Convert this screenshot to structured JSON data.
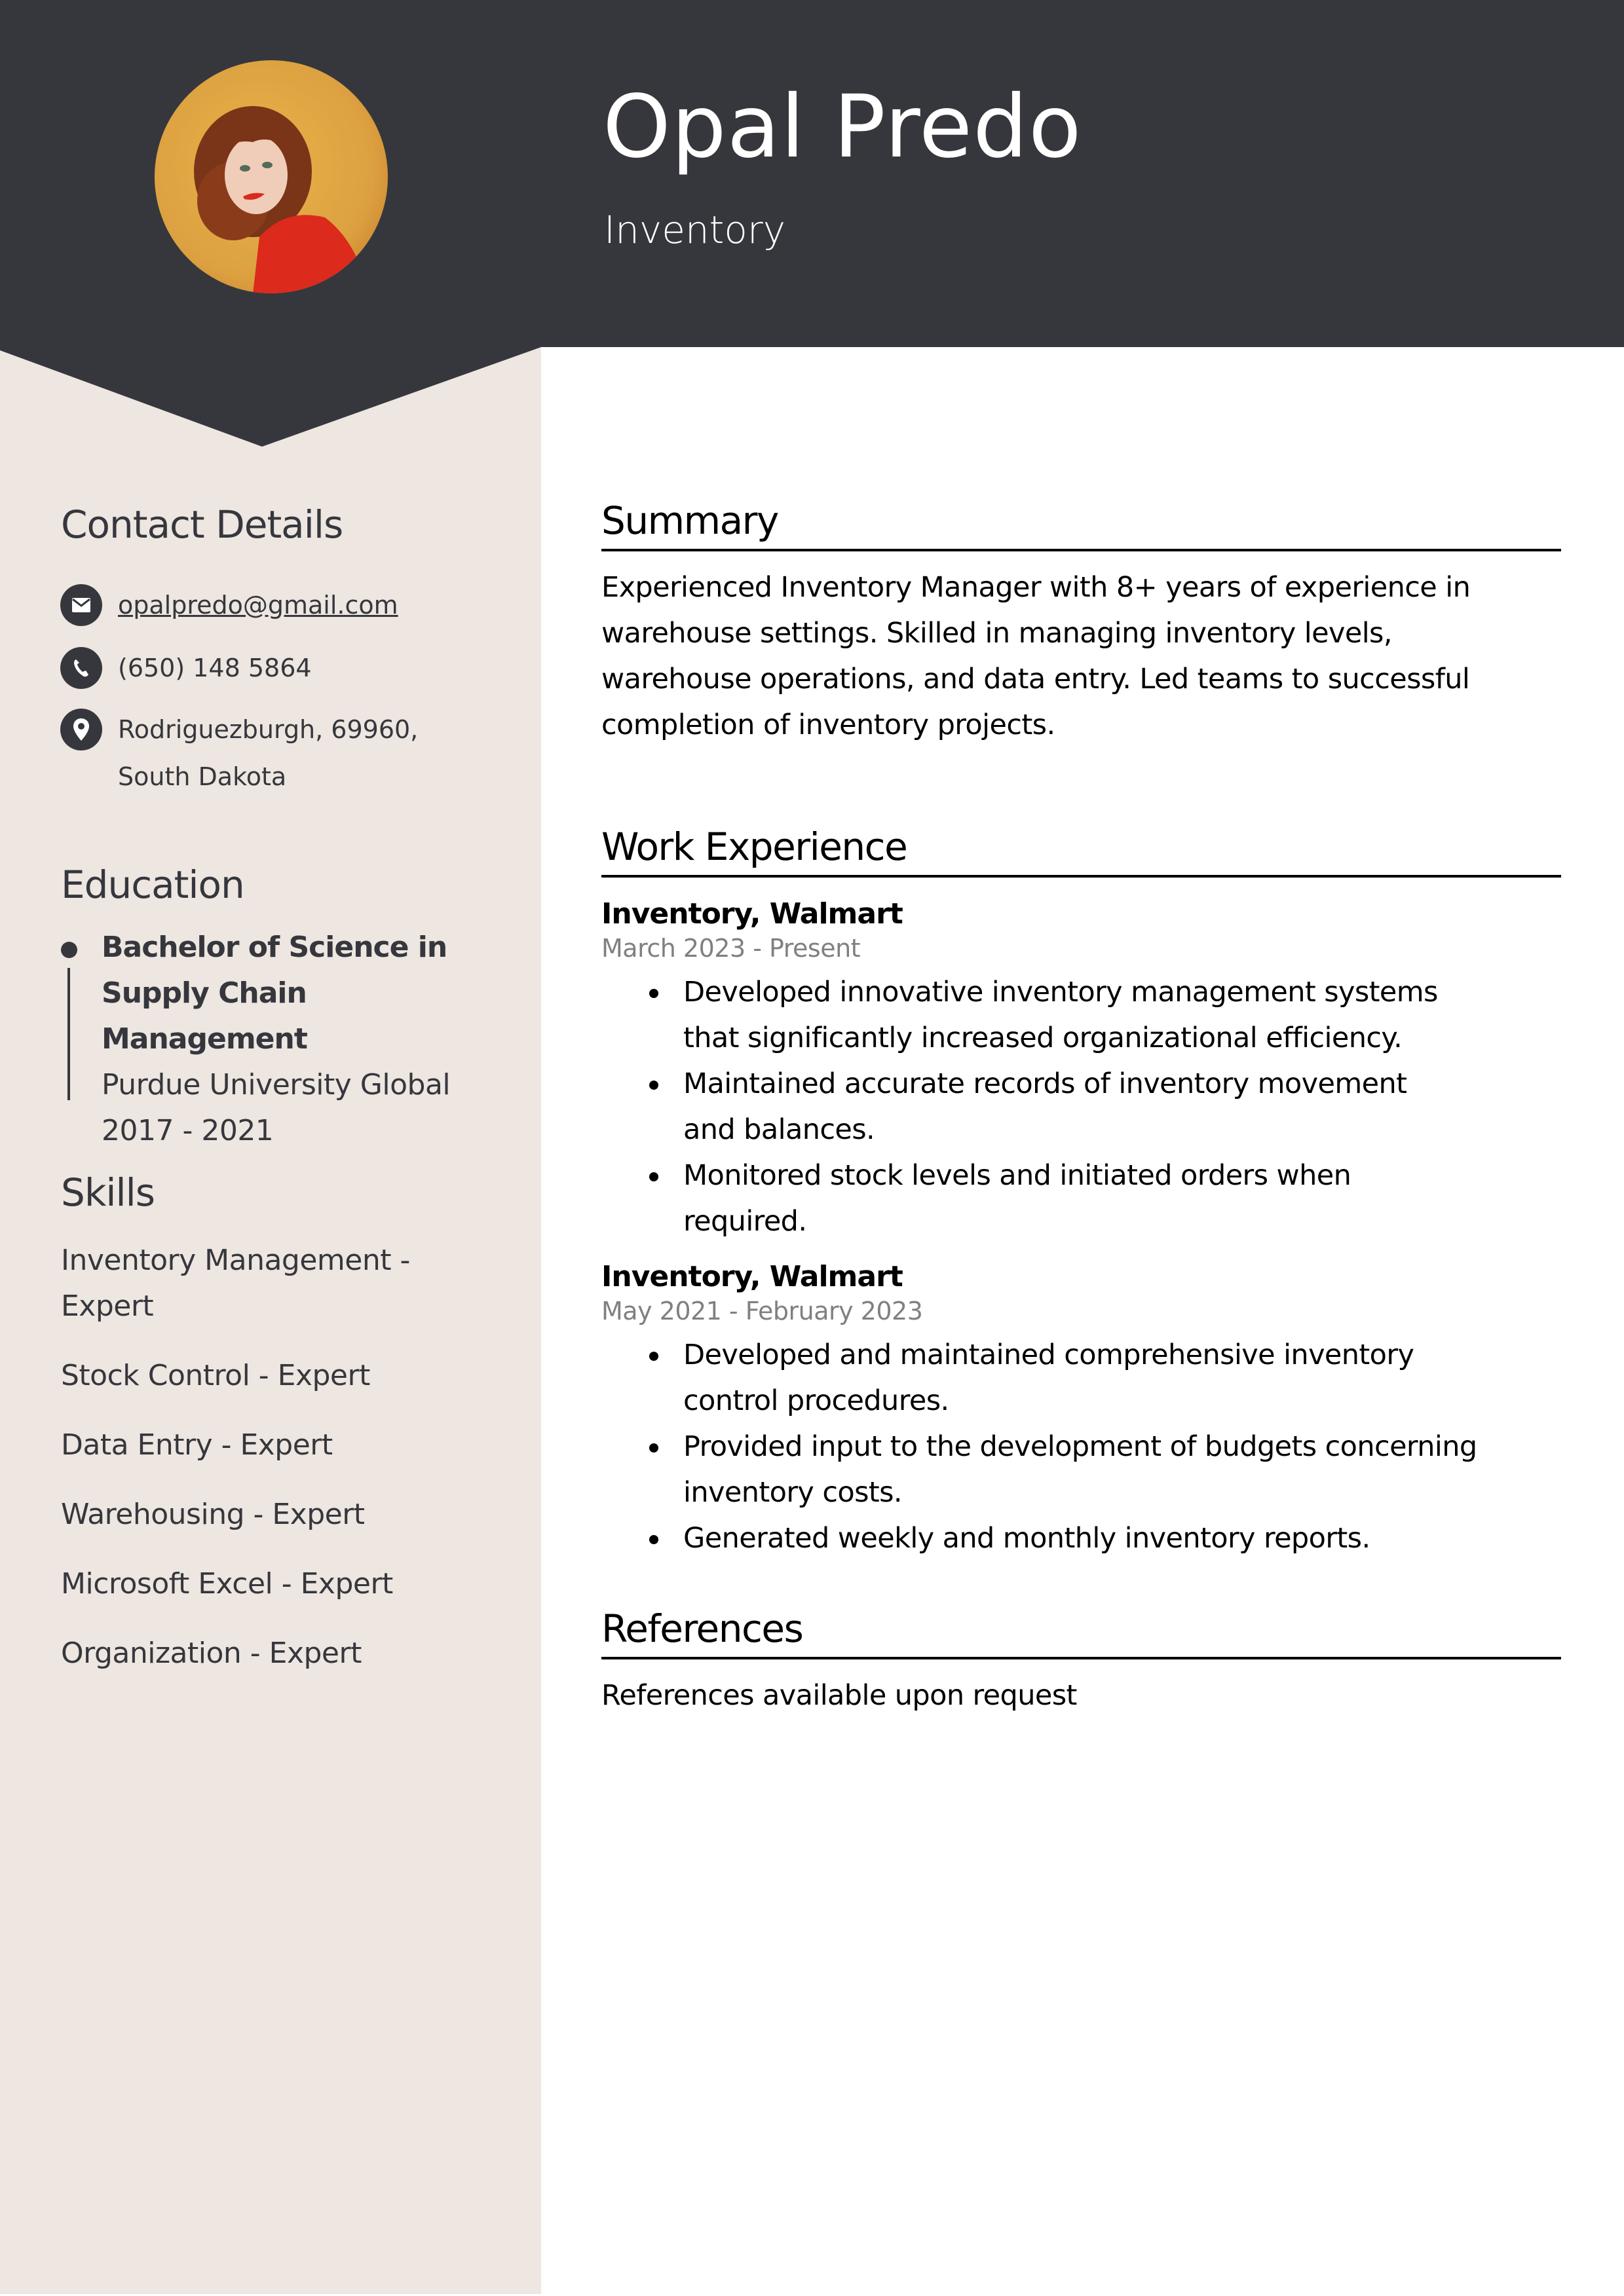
{
  "header": {
    "name": "Opal Predo",
    "title": "Inventory",
    "photo_alt": "profile-photo"
  },
  "colors": {
    "header_bg": "#36373d",
    "sidebar_bg": "#ede6e1",
    "text_dark": "#36373d",
    "date_gray": "#808080"
  },
  "sidebar": {
    "contact": {
      "heading": "Contact Details",
      "email": "opalpredo@gmail.com",
      "phone": "(650) 148 5864",
      "address": "Rodriguezburgh, 69960, South Dakota",
      "icons": [
        "envelope-icon",
        "phone-icon",
        "location-pin-icon"
      ]
    },
    "education": {
      "heading": "Education",
      "degree": "Bachelor of Science in Supply Chain Management",
      "school": "Purdue University Global",
      "years": "2017 - 2021"
    },
    "skills": {
      "heading": "Skills",
      "items": [
        "Inventory Management - Expert",
        "Stock Control - Expert",
        "Data Entry - Expert",
        "Warehousing - Expert",
        "Microsoft Excel - Expert",
        "Organization - Expert"
      ]
    }
  },
  "main": {
    "summary": {
      "heading": "Summary",
      "text": "Experienced Inventory Manager with 8+ years of experience in warehouse settings. Skilled in managing inventory levels, warehouse operations, and data entry. Led teams to successful completion of inventory projects."
    },
    "work": {
      "heading": "Work Experience",
      "jobs": [
        {
          "title": "Inventory, Walmart",
          "dates": "March 2023 - Present",
          "bullets": [
            "Developed innovative inventory management systems that significantly increased organizational efficiency.",
            "Maintained accurate records of inventory movement and balances.",
            "Monitored stock levels and initiated orders when required."
          ]
        },
        {
          "title": "Inventory, Walmart",
          "dates": "May 2021 - February 2023",
          "bullets": [
            "Developed and maintained comprehensive inventory control procedures.",
            "Provided input to the development of budgets concerning inventory costs.",
            "Generated weekly and monthly inventory reports."
          ]
        }
      ]
    },
    "references": {
      "heading": "References",
      "text": "References available upon request"
    }
  }
}
